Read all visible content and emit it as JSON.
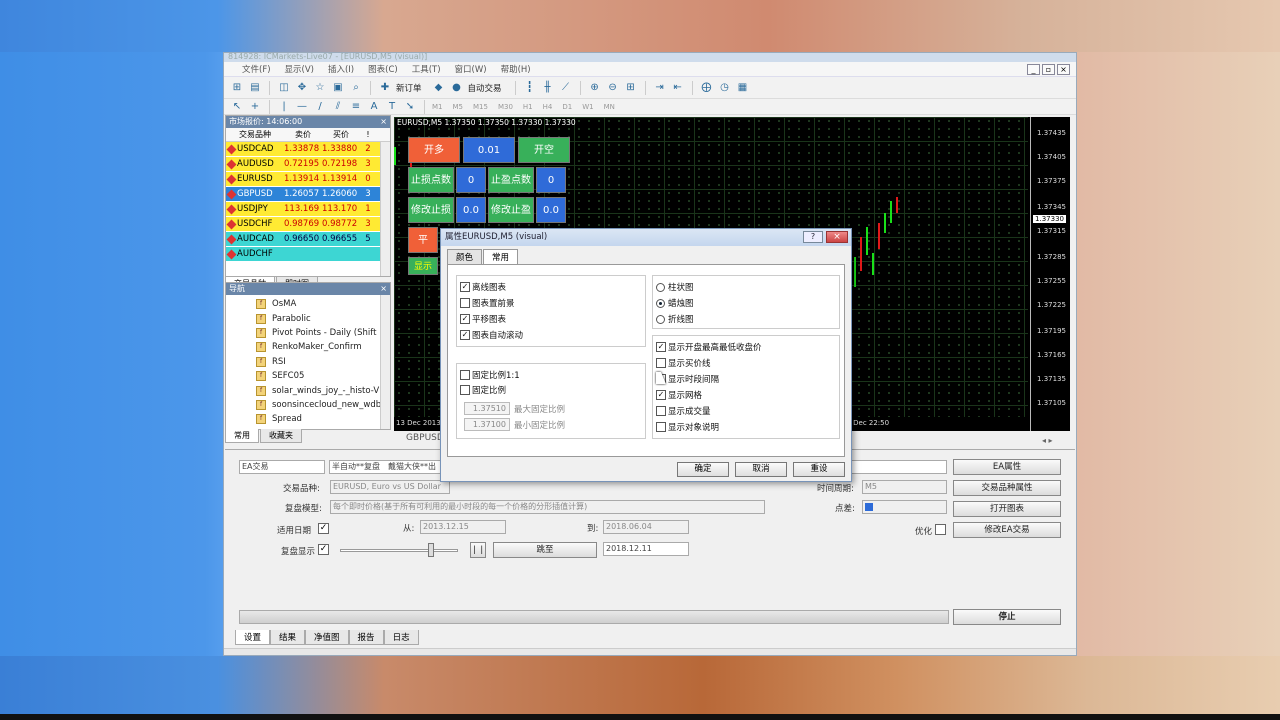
{
  "window": {
    "title": "814928: ICMarkets-Live07 - [EURUSD,M5 (visual)]"
  },
  "menu": [
    "文件(F)",
    "显示(V)",
    "插入(I)",
    "图表(C)",
    "工具(T)",
    "窗口(W)",
    "帮助(H)"
  ],
  "toolbar": {
    "new_order": "新订单",
    "auto_trade": "自动交易"
  },
  "timeframes": [
    "M1",
    "M5",
    "M15",
    "M30",
    "H1",
    "H4",
    "D1",
    "W1",
    "MN"
  ],
  "market_watch": {
    "title": "市场报价: 14:06:00",
    "headers": [
      "交易品种",
      "卖价",
      "买价",
      "!"
    ],
    "rows": [
      {
        "symbol": "USDCAD",
        "bid": "1.33878",
        "ask": "1.33880",
        "spread": "2",
        "style": "yellow"
      },
      {
        "symbol": "AUDUSD",
        "bid": "0.72195",
        "ask": "0.72198",
        "spread": "3",
        "style": "yellow"
      },
      {
        "symbol": "EURUSD",
        "bid": "1.13914",
        "ask": "1.13914",
        "spread": "0",
        "style": "yellow"
      },
      {
        "symbol": "GBPUSD",
        "bid": "1.26057",
        "ask": "1.26060",
        "spread": "3",
        "style": "blue"
      },
      {
        "symbol": "USDJPY",
        "bid": "113.169",
        "ask": "113.170",
        "spread": "1",
        "style": "yellow"
      },
      {
        "symbol": "USDCHF",
        "bid": "0.98769",
        "ask": "0.98772",
        "spread": "3",
        "style": "yellow"
      },
      {
        "symbol": "AUDCAD",
        "bid": "0.96650",
        "ask": "0.96655",
        "spread": "5",
        "style": "cyan"
      },
      {
        "symbol": "AUDCHF",
        "bid": "",
        "ask": "",
        "spread": "",
        "style": "cyan"
      }
    ],
    "tabs": [
      "交易品种",
      "即时图"
    ]
  },
  "navigator": {
    "title": "导航",
    "items": [
      "OsMA",
      "Parabolic",
      "Pivot Points - Daily (Shift",
      "RenkoMaker_Confirm",
      "RSI",
      "SEFC05",
      "solar_winds_joy_-_histo-V",
      "soonsincecloud_new_wdb",
      "Spread"
    ],
    "tabs": [
      "常用",
      "收藏夹"
    ]
  },
  "chart": {
    "title": "EURUSD,M5  1.37350 1.37350 1.37330 1.37330",
    "price_labels": [
      "1.37435",
      "1.37405",
      "1.37375",
      "1.37345",
      "1.37330",
      "1.37315",
      "1.37285",
      "1.37255",
      "1.37225",
      "1.37195",
      "1.37165",
      "1.37135",
      "1.37105"
    ],
    "time_labels": [
      "13 Dec 2013",
      "13 Dec 22:50"
    ],
    "tab": "GBPUSD",
    "panel_buttons": {
      "buy": "开多",
      "lot": "0.01",
      "sell": "开空",
      "sl_points": "止损点数",
      "sl_val": "0",
      "tp_points": "止盈点数",
      "tp_val": "0",
      "mod_sl": "修改止损",
      "mod_sl_val": "0.0",
      "mod_tp": "修改止盈",
      "mod_tp_val": "0.0",
      "close": "平",
      "show": "显示"
    }
  },
  "dialog": {
    "title": "属性EURUSD,M5 (visual)",
    "tabs": [
      "颜色",
      "常用"
    ],
    "left_options": [
      {
        "label": "离线图表",
        "checked": true
      },
      {
        "label": "图表置前景",
        "checked": false
      },
      {
        "label": "平移图表",
        "checked": true
      },
      {
        "label": "图表自动滚动",
        "checked": true
      }
    ],
    "scale_options": [
      {
        "label": "固定比例1:1",
        "checked": false
      },
      {
        "label": "固定比例",
        "checked": false
      }
    ],
    "fixed_max": "1.37510",
    "fixed_max_label": "最大固定比例",
    "fixed_min": "1.37100",
    "fixed_min_label": "最小固定比例",
    "chart_types": [
      {
        "label": "柱状图",
        "selected": false
      },
      {
        "label": "蜡烛图",
        "selected": true
      },
      {
        "label": "折线图",
        "selected": false
      }
    ],
    "right_options": [
      {
        "label": "显示开盘最高最低收盘价",
        "checked": true
      },
      {
        "label": "显示买价线",
        "checked": false
      },
      {
        "label": "显示时段间隔",
        "checked": false
      },
      {
        "label": "显示网格",
        "checked": true
      },
      {
        "label": "显示成交量",
        "checked": false
      },
      {
        "label": "显示对象说明",
        "checked": false
      }
    ],
    "buttons": {
      "ok": "确定",
      "cancel": "取消",
      "reset": "重设"
    }
  },
  "tester": {
    "type": "EA交易",
    "ea_name": "半自动**复盘　戴猫大侠**出",
    "symbol_label": "交易品种:",
    "symbol": "EURUSD, Euro vs US Dollar",
    "model_label": "复盘模型:",
    "model": "每个即时价格(基于所有可利用的最小时段的每一个价格的分形插值计算)",
    "use_date_label": "适用日期",
    "from_label": "从:",
    "from": "2013.12.15",
    "to_label": "到:",
    "to": "2018.06.04",
    "visual_label": "复盘显示",
    "skip_btn": "跳至",
    "skip_date": "2018.12.11",
    "period_label": "时间周期:",
    "period": "M5",
    "spread_label": "点差:",
    "optimize_label": "优化",
    "buttons": [
      "EA属性",
      "交易品种属性",
      "打开图表",
      "修改EA交易"
    ],
    "stop": "停止",
    "tabs": [
      "设置",
      "结果",
      "净值图",
      "报告",
      "日志"
    ]
  }
}
